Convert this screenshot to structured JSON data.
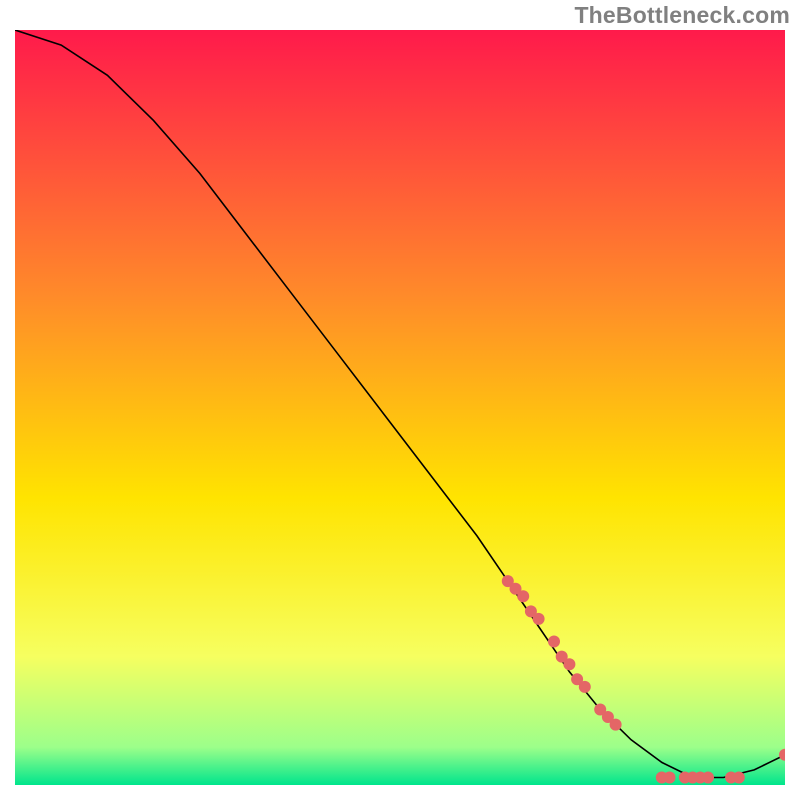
{
  "watermark": "TheBottleneck.com",
  "colors": {
    "gradient_top": "#ff1a4b",
    "gradient_mid1": "#ff8a2a",
    "gradient_mid2": "#ffe400",
    "gradient_mid3": "#f6ff60",
    "gradient_bot1": "#9cff8a",
    "gradient_bot2": "#00e58c",
    "curve": "#000000",
    "marker": "#e46666"
  },
  "chart_data": {
    "type": "line",
    "title": "",
    "xlabel": "",
    "ylabel": "",
    "xlim": [
      0,
      100
    ],
    "ylim": [
      0,
      100
    ],
    "series": [
      {
        "name": "curve",
        "x": [
          0,
          6,
          12,
          18,
          24,
          30,
          36,
          42,
          48,
          54,
          60,
          64,
          68,
          72,
          76,
          80,
          84,
          88,
          92,
          96,
          100
        ],
        "y": [
          100,
          98,
          94,
          88,
          81,
          73,
          65,
          57,
          49,
          41,
          33,
          27,
          21,
          15,
          10,
          6,
          3,
          1,
          1,
          2,
          4
        ]
      }
    ],
    "markers": [
      {
        "name": "pts-desc-1",
        "x": 64,
        "y": 27
      },
      {
        "name": "pts-desc-2",
        "x": 65,
        "y": 26
      },
      {
        "name": "pts-desc-3",
        "x": 66,
        "y": 25
      },
      {
        "name": "pts-desc-4",
        "x": 67,
        "y": 23
      },
      {
        "name": "pts-desc-5",
        "x": 68,
        "y": 22
      },
      {
        "name": "pts-desc-6",
        "x": 70,
        "y": 19
      },
      {
        "name": "pts-desc-7",
        "x": 71,
        "y": 17
      },
      {
        "name": "pts-desc-8",
        "x": 72,
        "y": 16
      },
      {
        "name": "pts-desc-9",
        "x": 73,
        "y": 14
      },
      {
        "name": "pts-desc-10",
        "x": 74,
        "y": 13
      },
      {
        "name": "pts-desc-11",
        "x": 76,
        "y": 10
      },
      {
        "name": "pts-desc-12",
        "x": 77,
        "y": 9
      },
      {
        "name": "pts-desc-13",
        "x": 78,
        "y": 8
      },
      {
        "name": "pts-flat-1",
        "x": 84,
        "y": 1
      },
      {
        "name": "pts-flat-2",
        "x": 85,
        "y": 1
      },
      {
        "name": "pts-flat-3",
        "x": 87,
        "y": 1
      },
      {
        "name": "pts-flat-4",
        "x": 88,
        "y": 1
      },
      {
        "name": "pts-flat-5",
        "x": 89,
        "y": 1
      },
      {
        "name": "pts-flat-6",
        "x": 90,
        "y": 1
      },
      {
        "name": "pts-flat-7",
        "x": 93,
        "y": 1
      },
      {
        "name": "pts-flat-8",
        "x": 94,
        "y": 1
      },
      {
        "name": "pts-up-1",
        "x": 100,
        "y": 4
      }
    ]
  }
}
